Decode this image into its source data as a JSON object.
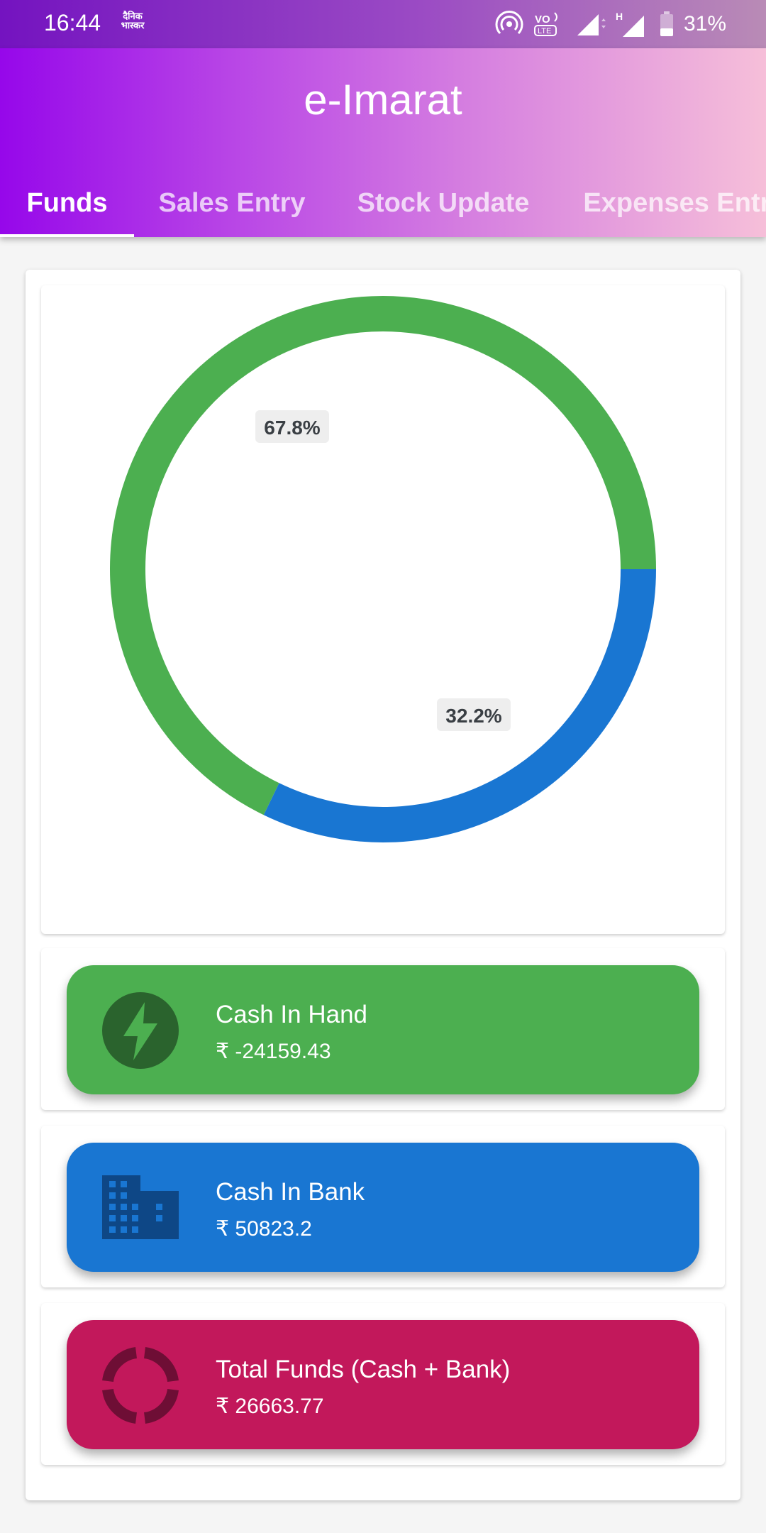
{
  "status_bar": {
    "time": "16:44",
    "news_icon": "dainik-bhaskar-icon",
    "news_text": "दैनिक भास्कर",
    "battery_percent": "31%"
  },
  "app": {
    "title": "e-Imarat"
  },
  "tabs": [
    {
      "label": "Funds",
      "active": true
    },
    {
      "label": "Sales Entry",
      "active": false
    },
    {
      "label": "Stock Update",
      "active": false
    },
    {
      "label": "Expenses Entry",
      "active": false
    }
  ],
  "chart_data": {
    "type": "pie",
    "labels": [
      "Cash In Hand",
      "Cash In Bank"
    ],
    "values": [
      67.8,
      32.2
    ],
    "data_labels": [
      "67.8%",
      "32.2%"
    ],
    "colors": [
      "#4caf50",
      "#1976d2"
    ]
  },
  "funds": [
    {
      "label": "Cash In Hand",
      "value": "₹ -24159.43",
      "color": "#4caf50",
      "icon_color": "#2a632d",
      "icon": "lightning-bolt-icon"
    },
    {
      "label": "Cash In Bank",
      "value": "₹ 50823.2",
      "color": "#1976d2",
      "icon_color": "#0e4786",
      "icon": "building-icon"
    },
    {
      "label": "Total Funds (Cash + Bank)",
      "value": "₹ 26663.77",
      "color": "#c2185b",
      "icon_color": "#6e0e35",
      "icon": "donut-chart-icon"
    }
  ]
}
